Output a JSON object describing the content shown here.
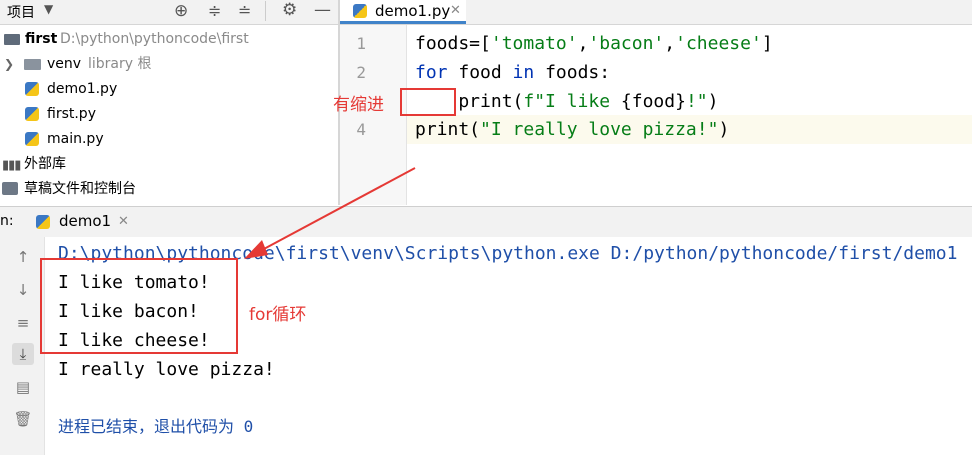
{
  "project_panel": {
    "title": "项目",
    "tree": [
      {
        "name": "first",
        "path": "D:\\python\\pythoncode\\first"
      },
      {
        "name": "venv",
        "tag": "library 根"
      },
      {
        "name": "demo1.py"
      },
      {
        "name": "first.py"
      },
      {
        "name": "main.py"
      },
      {
        "name": "外部库"
      },
      {
        "name": "草稿文件和控制台"
      }
    ]
  },
  "editor": {
    "tab_label": "demo1.py",
    "line_numbers": [
      "1",
      "2",
      "",
      "4"
    ],
    "code": {
      "l1_a": "foods=[",
      "l1_s1": "'tomato'",
      "l1_c1": ",",
      "l1_s2": "'bacon'",
      "l1_c2": ",",
      "l1_s3": "'cheese'",
      "l1_b": "]",
      "l2_for": "for",
      "l2_mid": " food ",
      "l2_in": "in",
      "l2_end": " foods:",
      "l3_a": "    print(",
      "l3_s": "f\"I like ",
      "l3_var": "{food}",
      "l3_s2": "!\"",
      "l3_b": ")",
      "l4_a": "print(",
      "l4_s": "\"I really love pizza!\"",
      "l4_b": ")"
    }
  },
  "run_panel": {
    "prefix": "n:",
    "tab_label": "demo1",
    "console_lines": [
      "D:\\python\\pythoncode\\first\\venv\\Scripts\\python.exe D:/python/pythoncode/first/demo1",
      "I like tomato!",
      "I like bacon!",
      "I like cheese!",
      "I really love pizza!",
      "",
      "进程已结束，退出代码为 0"
    ]
  },
  "annotations": {
    "indent_label": "有缩进",
    "loop_label": "for循环"
  },
  "colors": {
    "annotation": "#e53935",
    "keyword": "#0033b3",
    "string": "#067d17",
    "console_cmd": "#1f4fa8"
  }
}
